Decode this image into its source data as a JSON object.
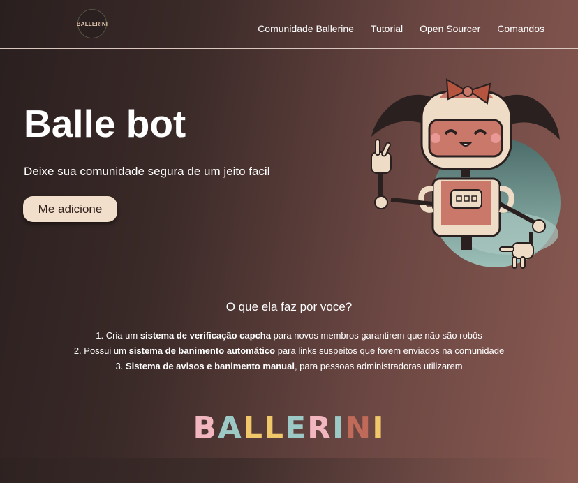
{
  "nav": {
    "logo_text": "BALLERINI",
    "links": [
      "Comunidade Ballerine",
      "Tutorial",
      "Open Sourcer",
      "Comandos"
    ]
  },
  "hero": {
    "title": "Balle bot",
    "subtitle": "Deixe sua comunidade segura de um jeito facil",
    "button_label": "Me adicione"
  },
  "features": {
    "heading": "O que ela faz por voce?",
    "items": [
      {
        "num": "1. ",
        "pre": "Cria um ",
        "bold": "sistema de verificação capcha",
        "post": " para novos membros garantirem que não são robôs"
      },
      {
        "num": "2. ",
        "pre": "Possui um ",
        "bold": "sistema de banimento automático",
        "post": " para links suspeitos que forem enviados na comunidade"
      },
      {
        "num": "3. ",
        "pre": "",
        "bold": "Sistema de avisos e banimento manual",
        "post": ", para pessoas administradoras utilizarem"
      }
    ]
  },
  "footer": {
    "wordmark_letters": [
      "B",
      "A",
      "L",
      "L",
      "E",
      "R",
      "I",
      "N",
      "I"
    ],
    "wordmark_colors": [
      "#f2b6c0",
      "#9cc9c6",
      "#f0c86a",
      "#f0c86a",
      "#9cc9c6",
      "#f2b6c0",
      "#9cc9c6",
      "#c06a5a",
      "#f0c86a"
    ]
  },
  "colors": {
    "button_bg": "#f1dfcb",
    "robot_face": "#c9786a",
    "robot_body": "#efdcc6"
  }
}
